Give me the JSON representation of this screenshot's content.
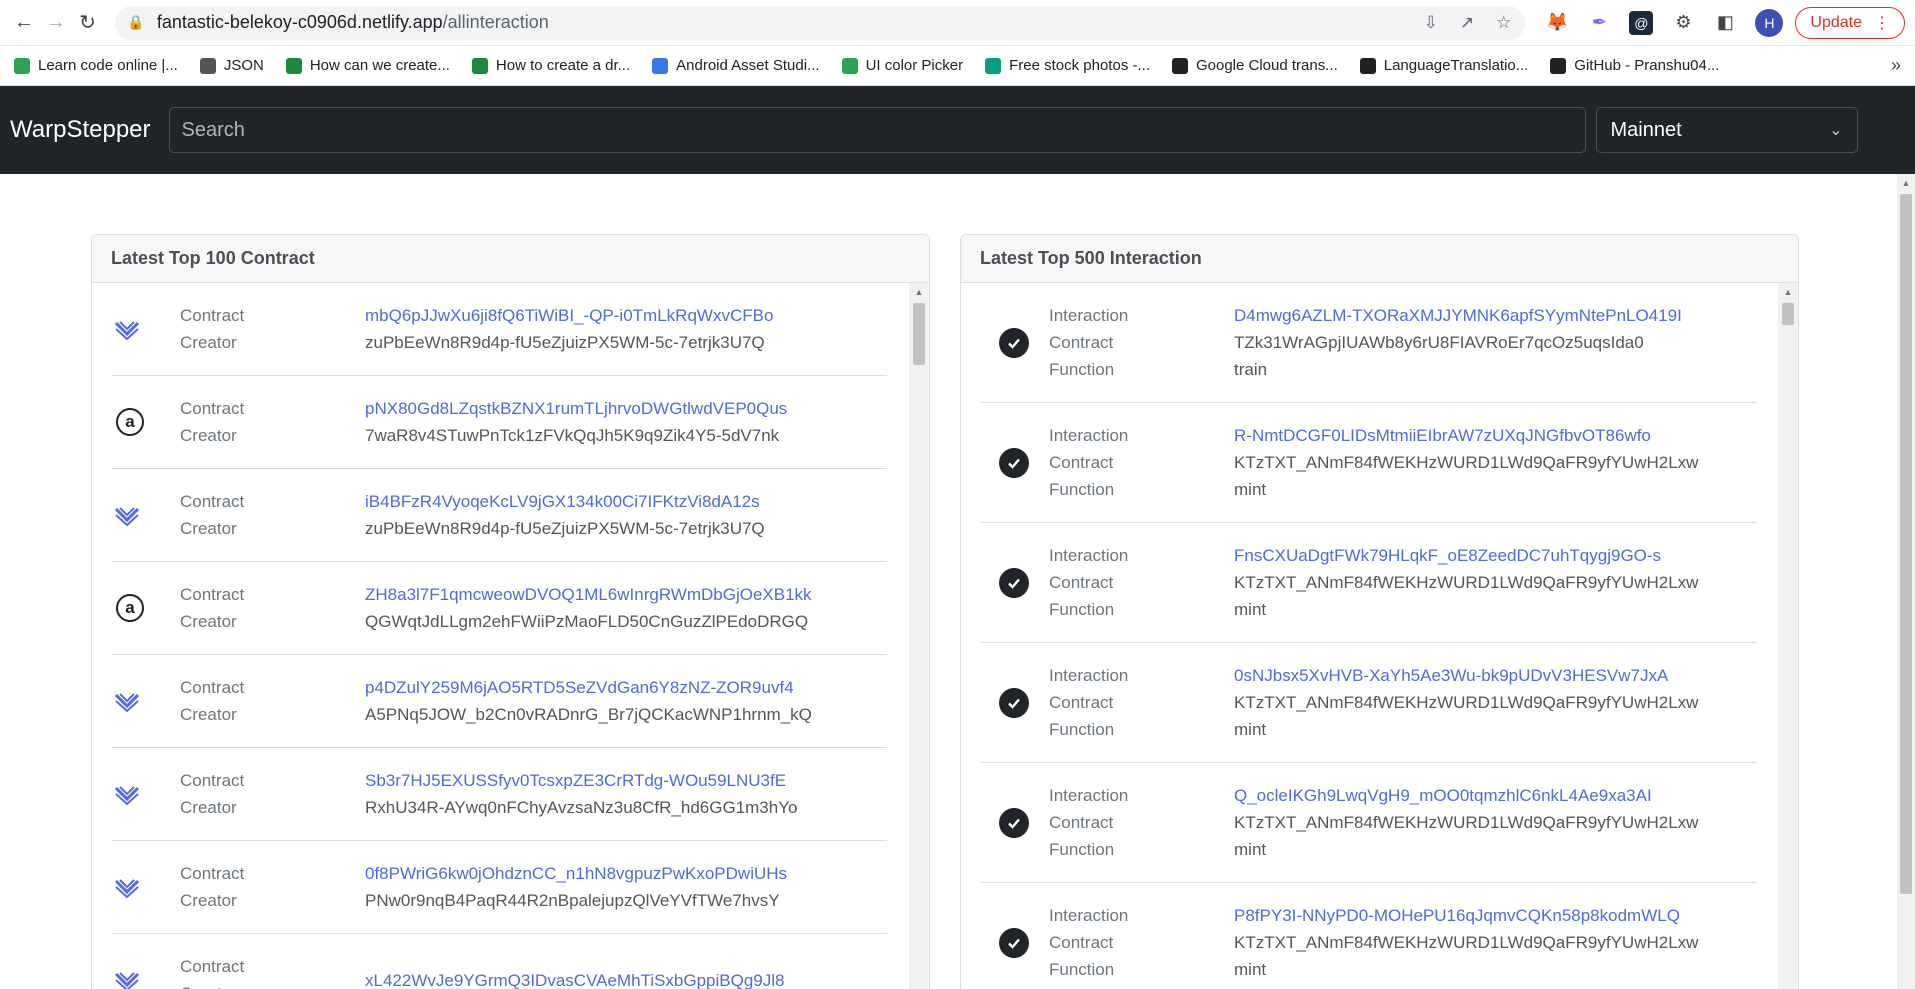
{
  "browser": {
    "url_host": "fantastic-belekoy-c0906d.netlify.app",
    "url_path": "/allinteraction",
    "avatar_letter": "H",
    "update_label": "Update",
    "bookmarks": [
      {
        "label": "Learn code online |...",
        "color": "#2ea44f"
      },
      {
        "label": "JSON",
        "color": "#555555"
      },
      {
        "label": "How can we create...",
        "color": "#1b8a3a"
      },
      {
        "label": "How to create a dr...",
        "color": "#1b8a3a"
      },
      {
        "label": "Android Asset Studi...",
        "color": "#3b78e7"
      },
      {
        "label": "UI color Picker",
        "color": "#2ea44f"
      },
      {
        "label": "Free stock photos -...",
        "color": "#05a081"
      },
      {
        "label": "Google Cloud trans...",
        "color": "#222222"
      },
      {
        "label": "LanguageTranslatio...",
        "color": "#222222"
      },
      {
        "label": "GitHub - Pranshu04...",
        "color": "#222222"
      }
    ]
  },
  "navbar": {
    "brand": "WarpStepper",
    "search_placeholder": "Search",
    "network": "Mainnet"
  },
  "contracts": {
    "title": "Latest Top 100 Contract",
    "label_contract": "Contract",
    "label_creator": "Creator",
    "rows": [
      {
        "icon": "warp",
        "contract": "mbQ6pJJwXu6ji8fQ6TiWiBI_-QP-i0TmLkRqWxvCFBo",
        "creator": "zuPbEeWn8R9d4p-fU5eZjuizPX5WM-5c-7etrjk3U7Q"
      },
      {
        "icon": "arweave",
        "contract": "pNX80Gd8LZqstkBZNX1rumTLjhrvoDWGtlwdVEP0Qus",
        "creator": "7waR8v4STuwPnTck1zFVkQqJh5K9q9Zik4Y5-5dV7nk"
      },
      {
        "icon": "warp",
        "contract": "iB4BFzR4VyoqeKcLV9jGX134k00Ci7IFKtzVi8dA12s",
        "creator": "zuPbEeWn8R9d4p-fU5eZjuizPX5WM-5c-7etrjk3U7Q"
      },
      {
        "icon": "arweave",
        "contract": "ZH8a3l7F1qmcweowDVOQ1ML6wInrgRWmDbGjOeXB1kk",
        "creator": "QGWqtJdLLgm2ehFWiiPzMaoFLD50CnGuzZlPEdoDRGQ"
      },
      {
        "icon": "warp",
        "contract": "p4DZulY259M6jAO5RTD5SeZVdGan6Y8zNZ-ZOR9uvf4",
        "creator": "A5PNq5JOW_b2Cn0vRADnrG_Br7jQCKacWNP1hrnm_kQ"
      },
      {
        "icon": "warp",
        "contract": "Sb3r7HJ5EXUSSfyv0TcsxpZE3CrRTdg-WOu59LNU3fE",
        "creator": "RxhU34R-AYwq0nFChyAvzsaNz3u8CfR_hd6GG1m3hYo"
      },
      {
        "icon": "warp",
        "contract": "0f8PWriG6kw0jOhdznCC_n1hN8vgpuzPwKxoPDwiUHs",
        "creator": "PNw0r9nqB4PaqR44R2nBpalejupzQlVeYVfTWe7hvsY"
      },
      {
        "icon": "warp",
        "contract": "xL422WvJe9YGrmQ3IDvasCVAeMhTiSxbGppiBQg9Jl8",
        "creator": ""
      }
    ]
  },
  "interactions": {
    "title": "Latest Top 500 Interaction",
    "label_interaction": "Interaction",
    "label_contract": "Contract",
    "label_function": "Function",
    "rows": [
      {
        "interaction": "D4mwg6AZLM-TXORaXMJJYMNK6apfSYymNtePnLO419I",
        "contract": "TZk31WrAGpjIUAWb8y6rU8FIAVRoEr7qcOz5uqsIda0",
        "function": "train"
      },
      {
        "interaction": "R-NmtDCGF0LIDsMtmiiEIbrAW7zUXqJNGfbvOT86wfo",
        "contract": "KTzTXT_ANmF84fWEKHzWURD1LWd9QaFR9yfYUwH2Lxw",
        "function": "mint"
      },
      {
        "interaction": "FnsCXUaDgtFWk79HLqkF_oE8ZeedDC7uhTqygj9GO-s",
        "contract": "KTzTXT_ANmF84fWEKHzWURD1LWd9QaFR9yfYUwH2Lxw",
        "function": "mint"
      },
      {
        "interaction": "0sNJbsx5XvHVB-XaYh5Ae3Wu-bk9pUDvV3HESVw7JxA",
        "contract": "KTzTXT_ANmF84fWEKHzWURD1LWd9QaFR9yfYUwH2Lxw",
        "function": "mint"
      },
      {
        "interaction": "Q_ocleIKGh9LwqVgH9_mOO0tqmzhlC6nkL4Ae9xa3AI",
        "contract": "KTzTXT_ANmF84fWEKHzWURD1LWd9QaFR9yfYUwH2Lxw",
        "function": "mint"
      },
      {
        "interaction": "P8fPY3I-NNyPD0-MOHePU16qJqmvCQKn58p8kodmWLQ",
        "contract": "KTzTXT_ANmF84fWEKHzWURD1LWd9QaFR9yfYUwH2Lxw",
        "function": "mint"
      }
    ]
  }
}
